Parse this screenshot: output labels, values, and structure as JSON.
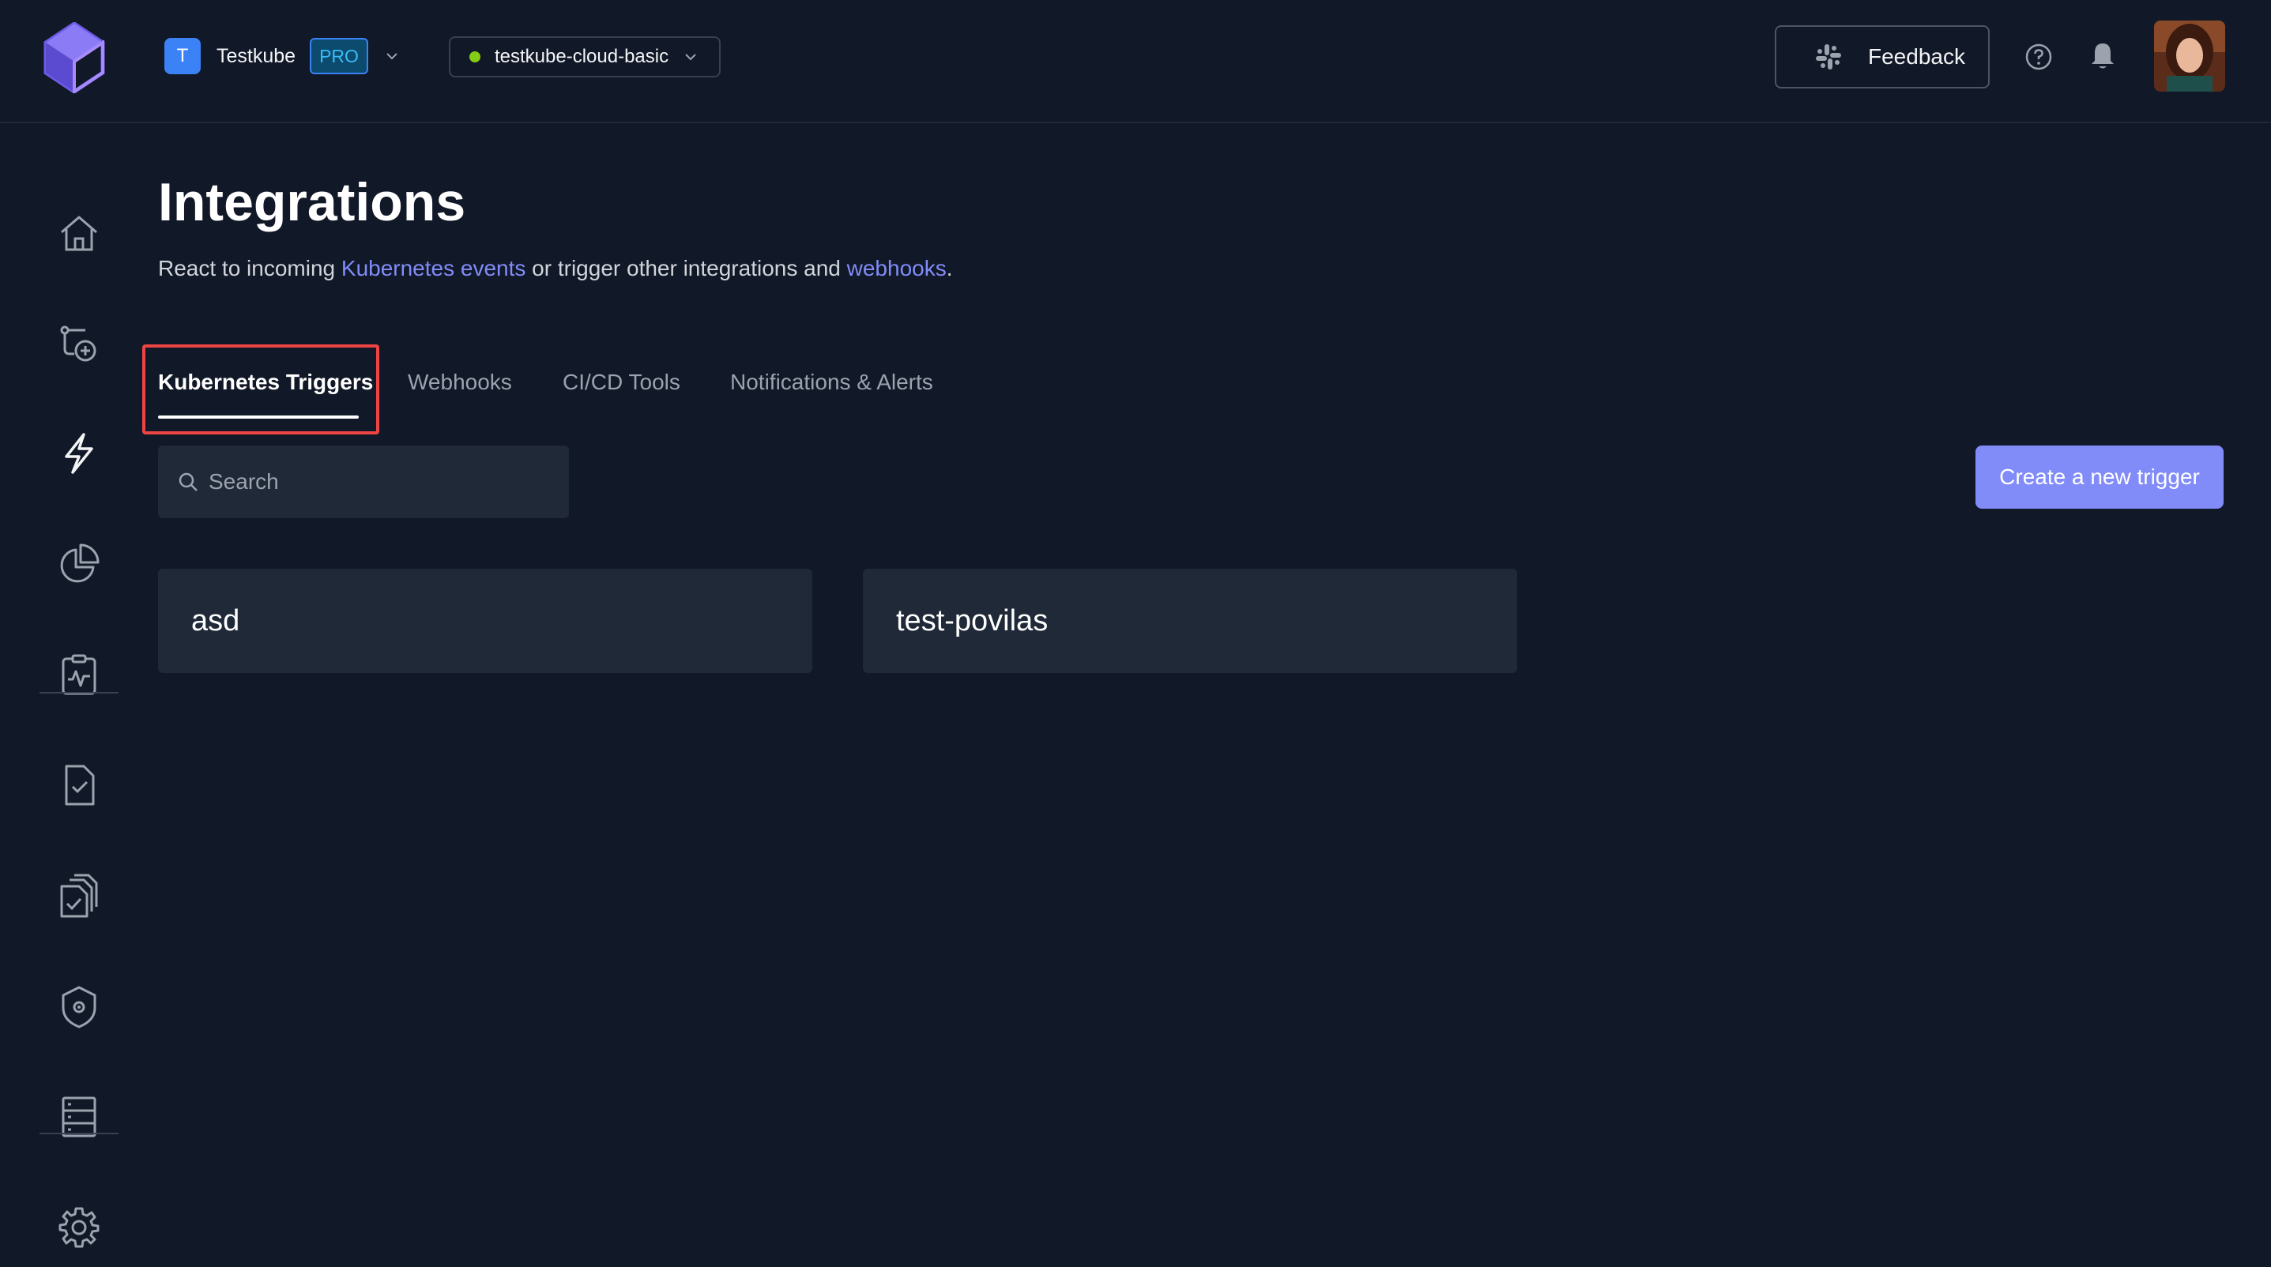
{
  "header": {
    "org": {
      "initial": "T",
      "name": "Testkube",
      "plan_badge": "PRO"
    },
    "environment": {
      "name": "testkube-cloud-basic",
      "status_color": "#84cc16"
    },
    "feedback_label": "Feedback"
  },
  "sidebar": {
    "items": [
      {
        "name": "home",
        "icon": "home-icon"
      },
      {
        "name": "add-test",
        "icon": "add-test-icon"
      },
      {
        "name": "integrations",
        "icon": "lightning-icon",
        "active": true
      },
      {
        "name": "analytics",
        "icon": "pie-chart-icon"
      },
      {
        "name": "status",
        "icon": "clipboard-pulse-icon"
      },
      {
        "name": "tests",
        "icon": "file-check-icon"
      },
      {
        "name": "test-suites",
        "icon": "files-check-icon"
      },
      {
        "name": "security",
        "icon": "shield-gear-icon"
      },
      {
        "name": "sources",
        "icon": "server-list-icon"
      },
      {
        "name": "settings",
        "icon": "gear-icon"
      }
    ]
  },
  "main": {
    "title": "Integrations",
    "subtitle": {
      "part1": "React to incoming ",
      "link1": "Kubernetes events",
      "part2": " or trigger other integrations and ",
      "link2": "webhooks",
      "part3": "."
    },
    "tabs": [
      {
        "label": "Kubernetes Triggers",
        "active": true
      },
      {
        "label": "Webhooks"
      },
      {
        "label": "CI/CD Tools"
      },
      {
        "label": "Notifications & Alerts"
      }
    ],
    "search": {
      "placeholder": "Search",
      "value": ""
    },
    "create_button_label": "Create a new trigger",
    "triggers": [
      {
        "name": "asd"
      },
      {
        "name": "test-povilas"
      }
    ]
  },
  "colors": {
    "background": "#111827",
    "card": "#1f2937",
    "accent": "#818cf8",
    "highlight": "#ef4444"
  }
}
